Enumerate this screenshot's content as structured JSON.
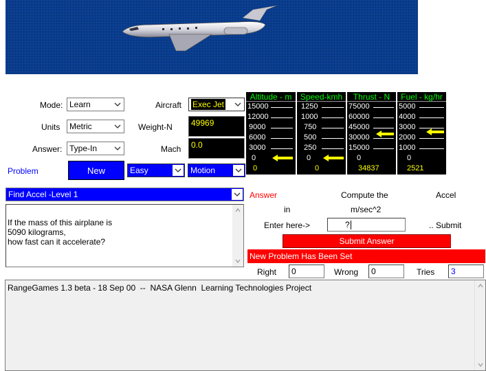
{
  "form": {
    "mode_label": "Mode:",
    "mode_value": "Learn",
    "units_label": "Units",
    "units_value": "Metric",
    "answer_label": "Answer:",
    "answer_value": "Type-In",
    "aircraft_label": "Aircraft",
    "aircraft_value": "Exec Jet",
    "weight_label": "Weight-N",
    "weight_value": "49969",
    "mach_label": "Mach",
    "mach_value": "0.0",
    "problem_label": "Problem",
    "new_button": "New",
    "difficulty_value": "Easy",
    "topic_value": "Motion"
  },
  "gauges": [
    {
      "title": "Altitude - m",
      "ticks": [
        "15000",
        "12000",
        "9000",
        "6000",
        "3000",
        "0"
      ],
      "value": "0"
    },
    {
      "title": "Speed-kmh",
      "ticks": [
        "1250",
        "1000",
        "750",
        "500",
        "250",
        "0"
      ],
      "value": "0"
    },
    {
      "title": "Thrust - N",
      "ticks": [
        "75000",
        "60000",
        "45000",
        "30000",
        "15000",
        "0"
      ],
      "value": "34837"
    },
    {
      "title": "Fuel - kg/hr",
      "ticks": [
        "5000",
        "4000",
        "3000",
        "2000",
        "1000",
        "0"
      ],
      "value": "2521"
    }
  ],
  "problem": {
    "select_value": "Find Accel -Level 1",
    "line1": "If the mass of this airplane is",
    "line2": "5090 kilograms,",
    "line3": "how fast can it accelerate?"
  },
  "answer": {
    "answer_label": "Answer",
    "compute_label": "Compute the",
    "quantity": "Accel",
    "in_label": "in",
    "units": "m/sec^2",
    "enter_label": "Enter here->",
    "input_value": "?",
    "submit_hint": ".. Submit",
    "submit_button": "Submit Answer",
    "status": "New Problem Has Been Set",
    "right_label": "Right",
    "right_value": "0",
    "wrong_label": "Wrong",
    "wrong_value": "0",
    "tries_label": "Tries",
    "tries_value": "3"
  },
  "log": {
    "text": "RangeGames 1.3 beta - 18 Sep 00  --  NASA Glenn  Learning Technologies Project"
  },
  "colors": {
    "sky": "#0a3c8c",
    "accent_blue": "#0000ff",
    "accent_red": "#ff0000",
    "gauge_title": "#00ff00",
    "gauge_value": "#ffff00"
  }
}
